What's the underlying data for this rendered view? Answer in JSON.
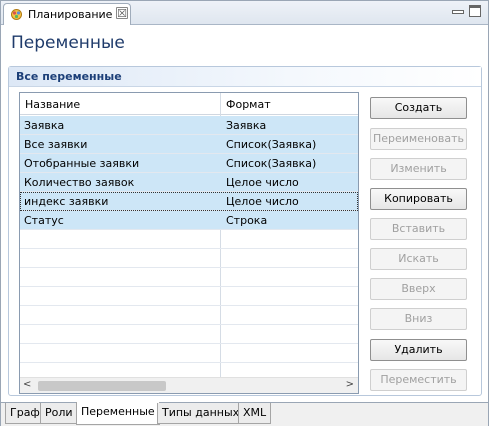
{
  "window": {
    "tab_title": "Планирование",
    "close_symbol": "☒",
    "app_icon": "eclipse-editor-icon"
  },
  "page": {
    "title": "Переменные"
  },
  "section": {
    "title": "Все переменные"
  },
  "table": {
    "headers": [
      "Название",
      "Формат"
    ],
    "rows": [
      {
        "name": "Заявка",
        "format": "Заявка"
      },
      {
        "name": "Все заявки",
        "format": "Список(Заявка)"
      },
      {
        "name": "Отобранные заявки",
        "format": "Список(Заявка)"
      },
      {
        "name": "Количество заявок",
        "format": "Целое число"
      },
      {
        "name": "индекс заявки",
        "format": "Целое число"
      },
      {
        "name": "Статус",
        "format": "Строка"
      }
    ],
    "scroll_left": "<",
    "scroll_right": ">"
  },
  "buttons": {
    "create": "Создать",
    "rename": "Переименовать",
    "edit": "Изменить",
    "copy": "Копировать",
    "paste": "Вставить",
    "search": "Искать",
    "up": "Вверх",
    "down": "Вниз",
    "delete": "Удалить",
    "move": "Переместить"
  },
  "bottom_tabs": [
    "Граф",
    "Роли",
    "Переменные",
    "Типы данных",
    "XML"
  ],
  "colors": {
    "selection": "#cde6f7",
    "title": "#1f3b6b",
    "section_title": "#1c3f78"
  }
}
